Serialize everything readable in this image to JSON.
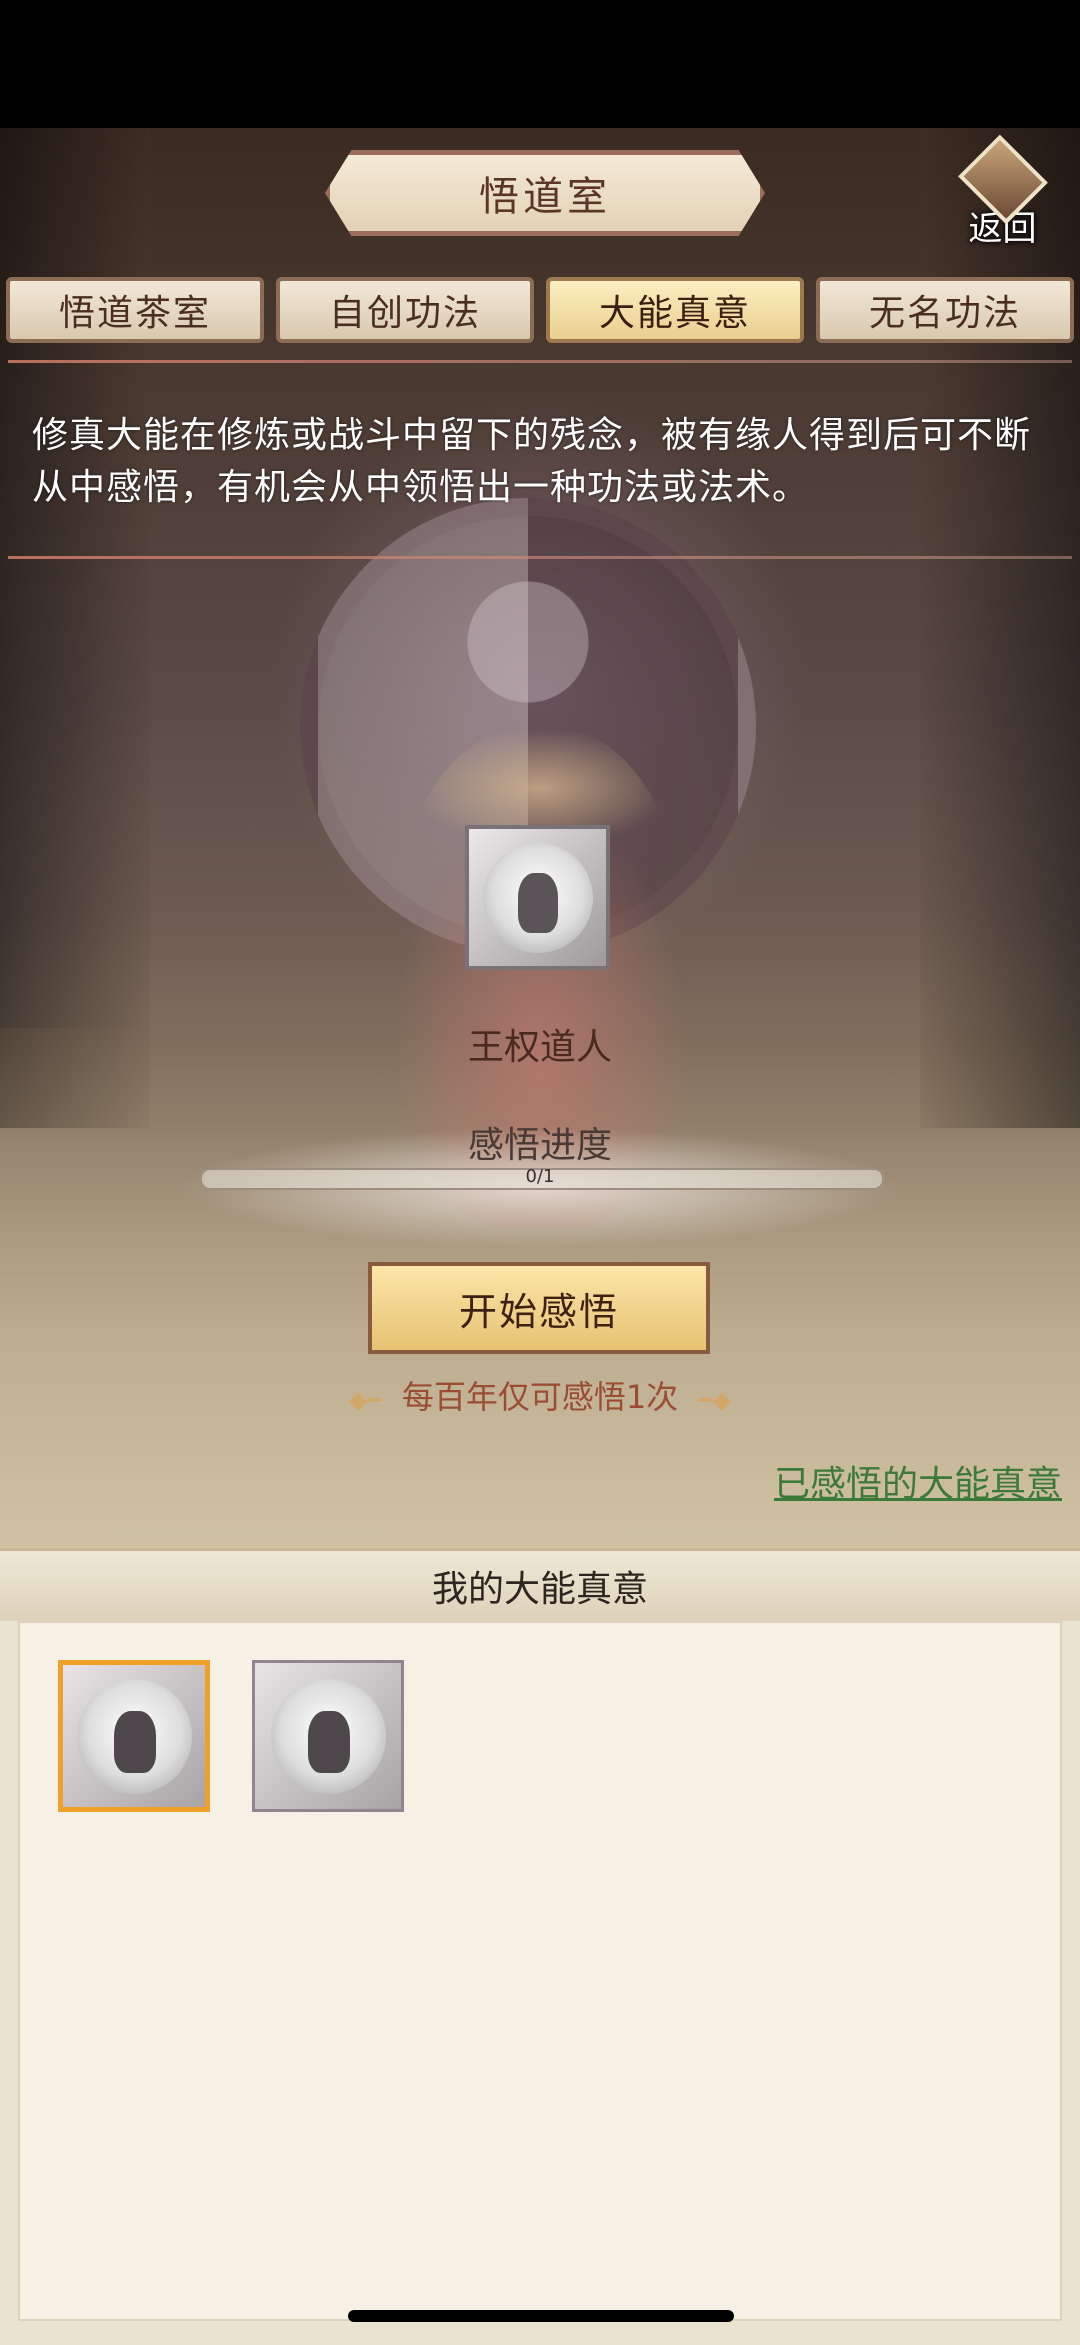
{
  "header": {
    "title": "悟道室",
    "back_label": "返回"
  },
  "tabs": [
    {
      "label": "悟道茶室",
      "active": false
    },
    {
      "label": "自创功法",
      "active": false
    },
    {
      "label": "大能真意",
      "active": true
    },
    {
      "label": "无名功法",
      "active": false
    }
  ],
  "description": "修真大能在修炼或战斗中留下的残念，被有缘人得到后可不断从中感悟，有机会从中领悟出一种功法或法术。",
  "character": {
    "name": "王权道人",
    "icon": "meditating-figure-icon"
  },
  "progress": {
    "label": "感悟进度",
    "text": "0/1",
    "fraction": 0
  },
  "start_button": {
    "label": "开始感悟"
  },
  "limit_note": "每百年仅可感悟1次",
  "known_link": "已感悟的大能真意",
  "panel": {
    "title": "我的大能真意",
    "slots": [
      {
        "icon": "meditating-figure-icon",
        "selected": true
      },
      {
        "icon": "meditating-figure-icon",
        "selected": false
      }
    ]
  },
  "colors": {
    "accent": "#f0a02a",
    "link": "#3d7a3a",
    "note": "#9a4d34"
  }
}
